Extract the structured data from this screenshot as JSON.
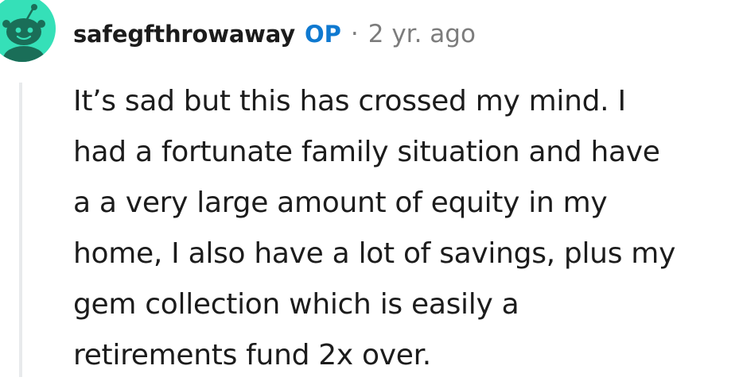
{
  "comment": {
    "avatar_icon": "snoo-avatar-icon",
    "avatar_color": "#35e0b8",
    "username": "safegfthrowaway",
    "op_badge": "OP",
    "separator": "·",
    "timestamp": "2 yr. ago",
    "op_color": "#0f79d0",
    "body_lines": [
      "It’s sad but this has crossed my mind. I",
      "had a fortunate family situation and have",
      "a a very large amount of equity in my",
      "home, I also have a lot of savings, plus my",
      "gem collection which is easily a",
      "retirements fund 2x over."
    ]
  }
}
